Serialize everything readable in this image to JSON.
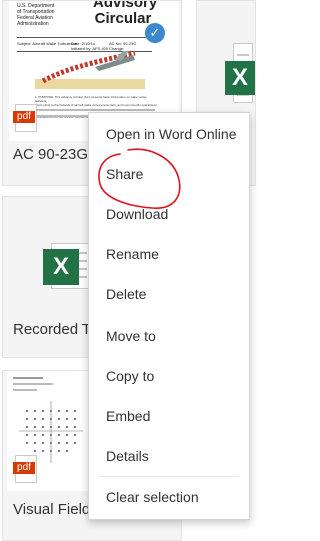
{
  "tiles": [
    {
      "name": "AC 90-23G",
      "thumb": {
        "header_lines": [
          "U.S. Department",
          "of Transportation",
          "Federal Aviation",
          "Administration"
        ],
        "title": "Advisory Circular",
        "subject": "Subject: Aircraft Wake Turbulence",
        "date": "Date: 2/10/14",
        "initiated": "Initiated by: AFS-400",
        "ac_no": "AC No: 90-23G",
        "change": "Change:",
        "body_start": "1. PURPOSE. This advisory circular (AC) presents basic information on wake vortex behavior,",
        "body_start2": "alerts pilots to the hazards of aircraft wake vortex encounters, and recommends operational",
        "body_start3": "CANCELLATION. AC 90-23F, Aircraft Wake Turbulence, dated February 20, 2002."
      },
      "icon": "pdf-icon",
      "icon_label": "pdf",
      "selected": true
    },
    {
      "name": "Recorded T",
      "icon": "excel-icon",
      "icon_letter": "X"
    },
    {
      "name": "Visual Field",
      "icon": "pdf-icon",
      "icon_label": "pdf"
    }
  ],
  "right_tiles": [
    {
      "icon": "excel-icon",
      "icon_letter": "X"
    }
  ],
  "context_menu": {
    "items": [
      "Open in Word Online",
      "Share",
      "Download",
      "Rename",
      "Delete",
      "Move to",
      "Copy to",
      "Embed",
      "Details",
      "Clear selection"
    ]
  },
  "colors": {
    "accent": "#3b88ce",
    "excel": "#217346",
    "pdf": "#d83b01",
    "annotation": "#e0121b"
  }
}
